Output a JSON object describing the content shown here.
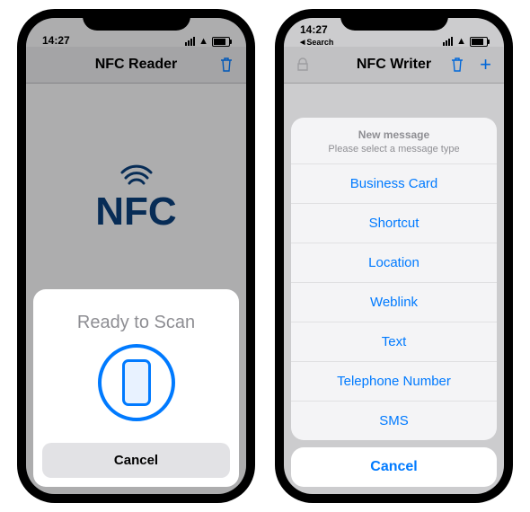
{
  "status": {
    "time": "14:27",
    "back_label": "Search"
  },
  "left": {
    "nav_title": "NFC Reader",
    "nfc_label": "NFC",
    "scan_prompt": "Ready to Scan",
    "cancel_label": "Cancel"
  },
  "right": {
    "nav_title": "NFC Writer",
    "sheet": {
      "title": "New message",
      "subtitle": "Please select a message type",
      "items": [
        "Business Card",
        "Shortcut",
        "Location",
        "Weblink",
        "Text",
        "Telephone Number",
        "SMS"
      ],
      "cancel_label": "Cancel"
    }
  }
}
